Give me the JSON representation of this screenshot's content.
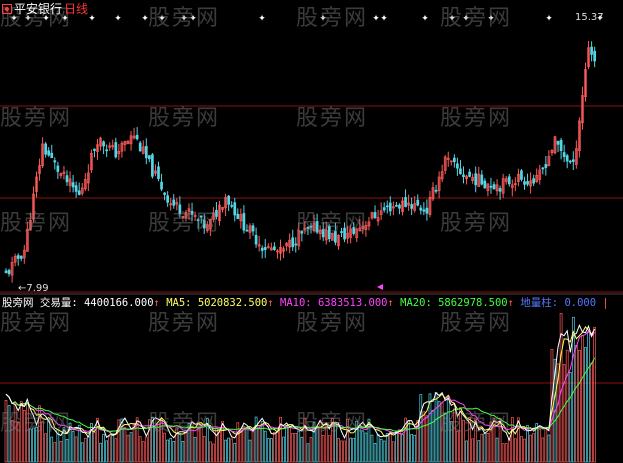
{
  "title": {
    "ticker": "平安银行",
    "period": "日线"
  },
  "price_labels": {
    "high": "15.37",
    "low": "7.99"
  },
  "volume_header": {
    "prefix": "股旁网",
    "volume_label": "交易量:",
    "volume_value": "4400166.000",
    "ma5_label": "MA5:",
    "ma5_value": "5020832.500",
    "ma10_label": "MA10:",
    "ma10_value": "6383513.000",
    "ma20_label": "MA20:",
    "ma20_value": "5862978.500",
    "dlz_label": "地量柱:",
    "dlz_value": "0.000",
    "trailing": "|",
    "arrow": "↑"
  },
  "watermark": "股旁网",
  "colors": {
    "up": "#ff5a5a",
    "down": "#54d6e6",
    "grid": "#8b1010",
    "ma5": "#ffffff",
    "ma10": "#ff44ff",
    "ma20": "#44ff44",
    "vol_line_yellow": "#ffff55",
    "dlz": "#5577ff",
    "value_text": "#ffff66"
  },
  "chart_data": [
    {
      "type": "candlestick",
      "ylim": [
        7.99,
        15.37
      ],
      "description_points": [
        {
          "day": 0,
          "close": 8.2
        },
        {
          "day": 6,
          "close": 8.9
        },
        {
          "day": 12,
          "close": 11.8
        },
        {
          "day": 18,
          "close": 11.0
        },
        {
          "day": 24,
          "close": 10.4
        },
        {
          "day": 30,
          "close": 12.0
        },
        {
          "day": 36,
          "close": 11.6
        },
        {
          "day": 42,
          "close": 12.1
        },
        {
          "day": 48,
          "close": 11.1
        },
        {
          "day": 54,
          "close": 10.2
        },
        {
          "day": 60,
          "close": 9.9
        },
        {
          "day": 66,
          "close": 9.5
        },
        {
          "day": 72,
          "close": 10.4
        },
        {
          "day": 78,
          "close": 9.6
        },
        {
          "day": 84,
          "close": 9.0
        },
        {
          "day": 90,
          "close": 8.8
        },
        {
          "day": 96,
          "close": 9.3
        },
        {
          "day": 102,
          "close": 9.5
        },
        {
          "day": 108,
          "close": 9.2
        },
        {
          "day": 114,
          "close": 9.4
        },
        {
          "day": 120,
          "close": 9.8
        },
        {
          "day": 126,
          "close": 10.1
        },
        {
          "day": 132,
          "close": 10.2
        },
        {
          "day": 138,
          "close": 10.0
        },
        {
          "day": 144,
          "close": 11.4
        },
        {
          "day": 150,
          "close": 11.0
        },
        {
          "day": 156,
          "close": 10.8
        },
        {
          "day": 162,
          "close": 10.7
        },
        {
          "day": 168,
          "close": 10.9
        },
        {
          "day": 174,
          "close": 10.8
        },
        {
          "day": 180,
          "close": 11.9
        },
        {
          "day": 186,
          "close": 11.2
        },
        {
          "day": 191,
          "close": 14.6
        },
        {
          "day": 193,
          "close": 14.2
        }
      ]
    },
    {
      "type": "bar",
      "series": [
        {
          "name": "交易量"
        },
        {
          "name": "MA5"
        },
        {
          "name": "MA10"
        },
        {
          "name": "MA20"
        },
        {
          "name": "地量柱"
        }
      ]
    }
  ]
}
